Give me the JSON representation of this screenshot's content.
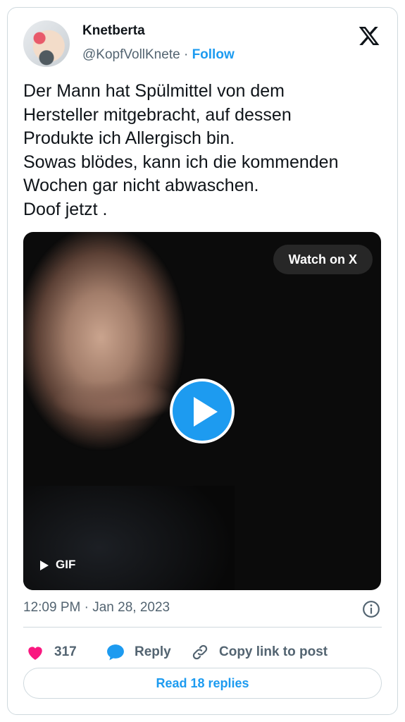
{
  "author": {
    "name": "Knetberta",
    "handle": "@KopfVollKnete",
    "separator": "·",
    "follow_label": "Follow"
  },
  "tweet": {
    "text": "Der Mann hat Spülmittel von dem\nHersteller mitgebracht, auf dessen\nProdukte ich Allergisch bin.\nSowas blödes, kann ich die kommenden\nWochen gar nicht abwaschen.\nDoof jetzt ."
  },
  "media": {
    "watch_label": "Watch on X",
    "gif_label": "GIF",
    "play_icon": "play-icon"
  },
  "timestamp": "12:09 PM · Jan 28, 2023",
  "actions": {
    "like_count": "317",
    "reply_label": "Reply",
    "copy_label": "Copy link to post"
  },
  "read_replies_label": "Read 18 replies",
  "colors": {
    "accent": "#1d9bf0",
    "like": "#f91880",
    "text": "#0f1419",
    "muted": "#536471",
    "border": "#cfd9de"
  }
}
